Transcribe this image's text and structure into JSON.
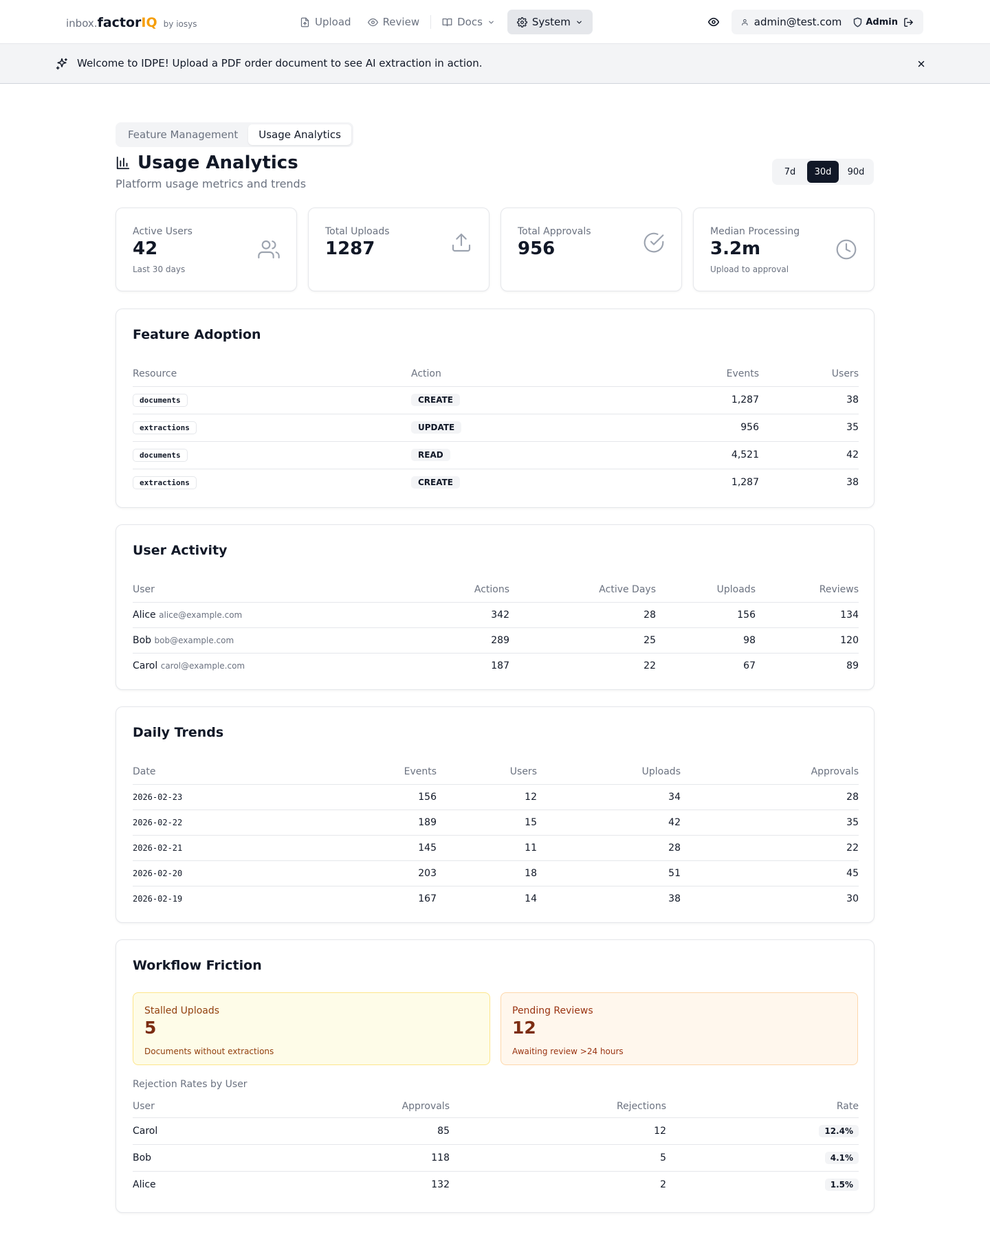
{
  "brand": {
    "prefix": "inbox.",
    "name": "factor",
    "suffix": "IQ",
    "by": "by iosys"
  },
  "nav": {
    "upload": "Upload",
    "review": "Review",
    "docs": "Docs",
    "system": "System"
  },
  "user": {
    "email": "admin@test.com",
    "role": "Admin"
  },
  "banner": {
    "message": "Welcome to IDPE! Upload a PDF order document to see AI extraction in action."
  },
  "tabs": [
    {
      "label": "Feature Management"
    },
    {
      "label": "Usage Analytics"
    }
  ],
  "page": {
    "title": "Usage Analytics",
    "subtitle": "Platform usage metrics and trends"
  },
  "range": {
    "options": [
      "7d",
      "30d",
      "90d"
    ],
    "selected": "30d"
  },
  "stats": [
    {
      "label": "Active Users",
      "value": "42",
      "sub": "Last 30 days",
      "icon": "users-icon"
    },
    {
      "label": "Total Uploads",
      "value": "1287",
      "sub": "",
      "icon": "upload-icon"
    },
    {
      "label": "Total Approvals",
      "value": "956",
      "sub": "",
      "icon": "check-circle-icon"
    },
    {
      "label": "Median Processing",
      "value": "3.2m",
      "sub": "Upload to approval",
      "icon": "clock-icon"
    }
  ],
  "feature_adoption": {
    "title": "Feature Adoption",
    "columns": [
      "Resource",
      "Action",
      "Events",
      "Users"
    ],
    "rows": [
      {
        "resource": "documents",
        "action": "CREATE",
        "events": "1,287",
        "users": "38"
      },
      {
        "resource": "extractions",
        "action": "UPDATE",
        "events": "956",
        "users": "35"
      },
      {
        "resource": "documents",
        "action": "READ",
        "events": "4,521",
        "users": "42"
      },
      {
        "resource": "extractions",
        "action": "CREATE",
        "events": "1,287",
        "users": "38"
      }
    ]
  },
  "user_activity": {
    "title": "User Activity",
    "columns": [
      "User",
      "Actions",
      "Active Days",
      "Uploads",
      "Reviews"
    ],
    "rows": [
      {
        "name": "Alice",
        "email": "alice@example.com",
        "actions": "342",
        "days": "28",
        "uploads": "156",
        "reviews": "134"
      },
      {
        "name": "Bob",
        "email": "bob@example.com",
        "actions": "289",
        "days": "25",
        "uploads": "98",
        "reviews": "120"
      },
      {
        "name": "Carol",
        "email": "carol@example.com",
        "actions": "187",
        "days": "22",
        "uploads": "67",
        "reviews": "89"
      }
    ]
  },
  "daily_trends": {
    "title": "Daily Trends",
    "columns": [
      "Date",
      "Events",
      "Users",
      "Uploads",
      "Approvals"
    ],
    "rows": [
      {
        "date": "2026-02-23",
        "events": "156",
        "users": "12",
        "uploads": "34",
        "approvals": "28"
      },
      {
        "date": "2026-02-22",
        "events": "189",
        "users": "15",
        "uploads": "42",
        "approvals": "35"
      },
      {
        "date": "2026-02-21",
        "events": "145",
        "users": "11",
        "uploads": "28",
        "approvals": "22"
      },
      {
        "date": "2026-02-20",
        "events": "203",
        "users": "18",
        "uploads": "51",
        "approvals": "45"
      },
      {
        "date": "2026-02-19",
        "events": "167",
        "users": "14",
        "uploads": "38",
        "approvals": "30"
      }
    ]
  },
  "workflow_friction": {
    "title": "Workflow Friction",
    "stalled": {
      "label": "Stalled Uploads",
      "value": "5",
      "sub": "Documents without extractions"
    },
    "pending": {
      "label": "Pending Reviews",
      "value": "12",
      "sub": "Awaiting review >24 hours"
    },
    "rejection_title": "Rejection Rates by User",
    "columns": [
      "User",
      "Approvals",
      "Rejections",
      "Rate"
    ],
    "rows": [
      {
        "user": "Carol",
        "approvals": "85",
        "rejections": "12",
        "rate": "12.4%"
      },
      {
        "user": "Bob",
        "approvals": "118",
        "rejections": "5",
        "rate": "4.1%"
      },
      {
        "user": "Alice",
        "approvals": "132",
        "rejections": "2",
        "rate": "1.5%"
      }
    ]
  }
}
